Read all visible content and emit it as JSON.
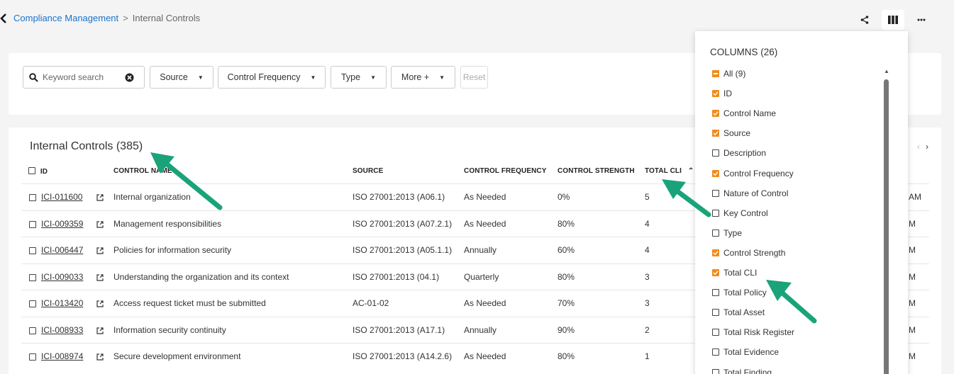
{
  "breadcrumb": {
    "parent": "Compliance Management",
    "separator": ">",
    "current": "Internal Controls"
  },
  "icons": {
    "back": "chevron-left-icon",
    "share": "share-icon",
    "columns": "columns-icon",
    "more": "more-horizontal-icon"
  },
  "filters": {
    "search_placeholder": "Keyword search",
    "source": "Source",
    "control_frequency": "Control Frequency",
    "type": "Type",
    "more": "More +",
    "reset": "Reset"
  },
  "table": {
    "title": "Internal Controls (385)",
    "headers": {
      "id": "ID",
      "control_name": "CONTROL NAME",
      "source": "SOURCE",
      "control_frequency": "CONTROL FREQUENCY",
      "control_strength": "CONTROL STRENGTH",
      "total_cli": "TOTAL CLI"
    },
    "rows": [
      {
        "id": "ICI-011600",
        "name": "Internal organization",
        "source": "ISO 27001:2013 (A06.1)",
        "frequency": "As Needed",
        "strength": "0%",
        "cli": "5",
        "trailing": "AM"
      },
      {
        "id": "ICI-009359",
        "name": "Management responsibilities",
        "source": "ISO 27001:2013 (A07.2.1)",
        "frequency": "As Needed",
        "strength": "80%",
        "cli": "4",
        "trailing": "M"
      },
      {
        "id": "ICI-006447",
        "name": "Policies for information security",
        "source": "ISO 27001:2013 (A05.1.1)",
        "frequency": "Annually",
        "strength": "60%",
        "cli": "4",
        "trailing": "M"
      },
      {
        "id": "ICI-009033",
        "name": "Understanding the organization and its context",
        "source": "ISO 27001:2013 (04.1)",
        "frequency": "Quarterly",
        "strength": "80%",
        "cli": "3",
        "trailing": "M"
      },
      {
        "id": "ICI-013420",
        "name": "Access request ticket must be submitted",
        "source": "AC-01-02",
        "frequency": "As Needed",
        "strength": "70%",
        "cli": "3",
        "trailing": "M"
      },
      {
        "id": "ICI-008933",
        "name": "Information security continuity",
        "source": "ISO 27001:2013 (A17.1)",
        "frequency": "Annually",
        "strength": "90%",
        "cli": "2",
        "trailing": "M"
      },
      {
        "id": "ICI-008974",
        "name": "Secure development environment",
        "source": "ISO 27001:2013 (A14.2.6)",
        "frequency": "As Needed",
        "strength": "80%",
        "cli": "1",
        "trailing": "M"
      }
    ]
  },
  "columns_panel": {
    "title": "COLUMNS (26)",
    "items": [
      {
        "label": "All (9)",
        "state": "partial"
      },
      {
        "label": "ID",
        "state": "on"
      },
      {
        "label": "Control Name",
        "state": "on"
      },
      {
        "label": "Source",
        "state": "on"
      },
      {
        "label": "Description",
        "state": "off"
      },
      {
        "label": "Control Frequency",
        "state": "on"
      },
      {
        "label": "Nature of Control",
        "state": "off"
      },
      {
        "label": "Key Control",
        "state": "off"
      },
      {
        "label": "Type",
        "state": "off"
      },
      {
        "label": "Control Strength",
        "state": "on"
      },
      {
        "label": "Total CLI",
        "state": "on"
      },
      {
        "label": "Total Policy",
        "state": "off"
      },
      {
        "label": "Total Asset",
        "state": "off"
      },
      {
        "label": "Total Risk Register",
        "state": "off"
      },
      {
        "label": "Total Evidence",
        "state": "off"
      },
      {
        "label": "Total Finding",
        "state": "off"
      }
    ]
  },
  "colors": {
    "link": "#1a73c9",
    "checked": "#f08c1e",
    "annotation_arrow": "#1aa37a"
  }
}
